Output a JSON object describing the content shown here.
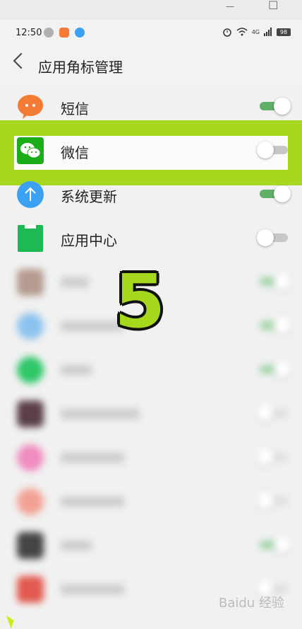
{
  "window": {
    "minimize_glyph": "—",
    "maximize_glyph": "☐"
  },
  "status": {
    "time": "12:50",
    "network": "4G",
    "battery": "98"
  },
  "header": {
    "title": "应用角标管理"
  },
  "apps": [
    {
      "label": "短信",
      "color": "#f47b33",
      "enabled": true
    },
    {
      "label": "微信",
      "color": "#1aad19",
      "enabled": false
    },
    {
      "label": "系统更新",
      "color": "#3ba1f2",
      "enabled": true
    },
    {
      "label": "应用中心",
      "color": "#1db954",
      "enabled": false
    }
  ],
  "overlay": {
    "step_number": "5",
    "watermark": "Baidu 经验"
  },
  "colors": {
    "highlight": "#a6d91e",
    "toggle_on": "#5fae6a",
    "toggle_off": "#c7c7c7"
  }
}
